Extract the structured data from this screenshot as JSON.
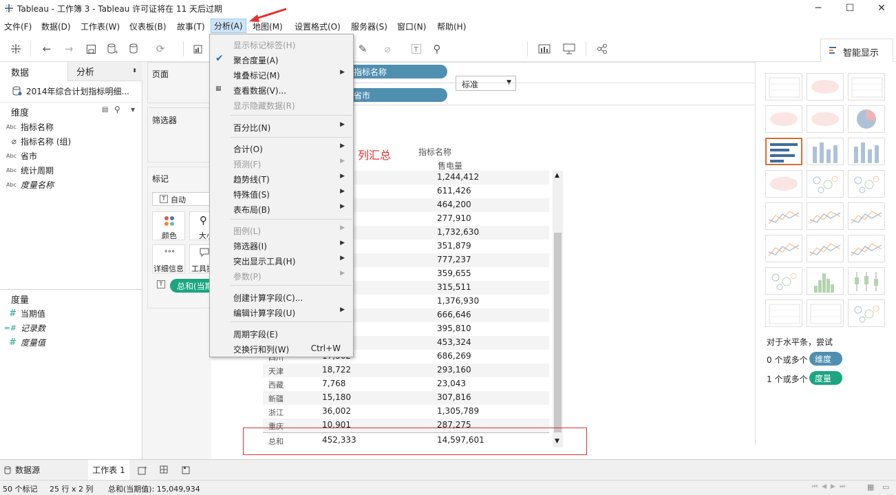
{
  "window": {
    "title": "Tableau - 工作簿 3 - Tableau 许可证将在 11 天后过期"
  },
  "menubar": [
    "文件(F)",
    "数据(D)",
    "工作表(W)",
    "仪表板(B)",
    "故事(T)",
    "分析(A)",
    "地图(M)",
    "设置格式(O)",
    "服务器(S)",
    "窗口(N)",
    "帮助(H)"
  ],
  "toolbar": {
    "fit_select": "标准",
    "show_me_label": "智能显示"
  },
  "left_pane": {
    "tab_data": "数据",
    "tab_analysis": "分析",
    "datasource": "2014年综合计划指标明细...",
    "dimensions_header": "维度",
    "dimensions": [
      {
        "icon": "Abc",
        "label": "指标名称"
      },
      {
        "icon": "@",
        "label": "指标名称 (组)"
      },
      {
        "icon": "Abc",
        "label": "省市"
      },
      {
        "icon": "Abc",
        "label": "统计周期"
      },
      {
        "icon": "Abc",
        "label": "度量名称"
      }
    ],
    "measures_header": "度量",
    "measures": [
      {
        "icon": "#",
        "label": "当期值"
      },
      {
        "icon": "=#",
        "label": "记录数"
      },
      {
        "icon": "#",
        "label": "度量值"
      }
    ]
  },
  "cards": {
    "pages": "页面",
    "filters": "筛选器",
    "marks": "标记",
    "mark_type": "自动",
    "color": "颜色",
    "size": "大小",
    "detail": "详细信息",
    "tooltip": "工具提示",
    "mark_pill": "总和(当期值)"
  },
  "shelves": {
    "columns_pill": "指标名称",
    "rows_pill": "省市"
  },
  "view": {
    "annotation": "列汇总",
    "col_header": "指标名称",
    "col_sub": "售电量",
    "rows": [
      {
        "prov": "",
        "v1": "",
        "v2": "1,244,412"
      },
      {
        "prov": "",
        "v1": "",
        "v2": "611,426"
      },
      {
        "prov": "",
        "v1": "",
        "v2": "464,200"
      },
      {
        "prov": "",
        "v1": "",
        "v2": "277,910"
      },
      {
        "prov": "",
        "v1": "",
        "v2": "1,732,630"
      },
      {
        "prov": "",
        "v1": "",
        "v2": "351,879"
      },
      {
        "prov": "",
        "v1": "",
        "v2": "777,237"
      },
      {
        "prov": "",
        "v1": "",
        "v2": "359,655"
      },
      {
        "prov": "",
        "v1": "",
        "v2": "315,511"
      },
      {
        "prov": "",
        "v1": "",
        "v2": "1,376,930"
      },
      {
        "prov": "",
        "v1": "",
        "v2": "666,646"
      },
      {
        "prov": "",
        "v1": "",
        "v2": "395,810"
      },
      {
        "prov": "",
        "v1": "",
        "v2": "453,324"
      },
      {
        "prov": "四川",
        "v1": "17,562",
        "v2": "686,269"
      },
      {
        "prov": "天津",
        "v1": "18,722",
        "v2": "293,160"
      },
      {
        "prov": "西藏",
        "v1": "7,768",
        "v2": "23,043"
      },
      {
        "prov": "新疆",
        "v1": "15,180",
        "v2": "307,816"
      },
      {
        "prov": "浙江",
        "v1": "36,002",
        "v2": "1,305,789"
      },
      {
        "prov": "重庆",
        "v1": "10,901",
        "v2": "287,275"
      }
    ],
    "total": {
      "prov": "总和",
      "v1": "452,333",
      "v2": "14,597,601"
    }
  },
  "dropdown": [
    {
      "label": "显示标记标签(H)",
      "disabled": true
    },
    {
      "label": "聚合度量(A)",
      "checked": true
    },
    {
      "label": "堆叠标记(M)",
      "submenu": true
    },
    {
      "label": "查看数据(V)...",
      "icon": true
    },
    {
      "label": "显示隐藏数据(R)",
      "disabled": true
    },
    {
      "label": "百分比(N)",
      "submenu": true
    },
    {
      "label": "合计(O)",
      "submenu": true
    },
    {
      "label": "预测(F)",
      "submenu": true,
      "disabled": true
    },
    {
      "label": "趋势线(T)",
      "submenu": true
    },
    {
      "label": "特殊值(S)",
      "submenu": true
    },
    {
      "label": "表布局(B)",
      "submenu": true
    },
    {
      "label": "图例(L)",
      "submenu": true,
      "disabled": true
    },
    {
      "label": "筛选器(I)",
      "submenu": true
    },
    {
      "label": "突出显示工具(H)",
      "submenu": true
    },
    {
      "label": "参数(P)",
      "submenu": true,
      "disabled": true
    },
    {
      "label": "创建计算字段(C)..."
    },
    {
      "label": "编辑计算字段(U)",
      "submenu": true
    },
    {
      "label": "周期字段(E)"
    },
    {
      "label": "交换行和列(W)",
      "shortcut": "Ctrl+W"
    }
  ],
  "show_me": {
    "hint": "对于水平条，尝试",
    "dim_prefix": "0 个或多个",
    "dim_badge": "维度",
    "meas_prefix": "1 个或多个",
    "meas_badge": "度量"
  },
  "bottom_tabs": {
    "datasource": "数据源",
    "sheet": "工作表 1"
  },
  "status": {
    "marks": "50 个标记",
    "rows_cols": "25 行 x 2 列",
    "sum": "总和(当期值): 15,049,934"
  },
  "colors": {
    "pill_blue": "#4f8fb0",
    "pill_green": "#1ba580",
    "annotation_red": "#e03030",
    "menu_highlight": "#cce4f7"
  }
}
